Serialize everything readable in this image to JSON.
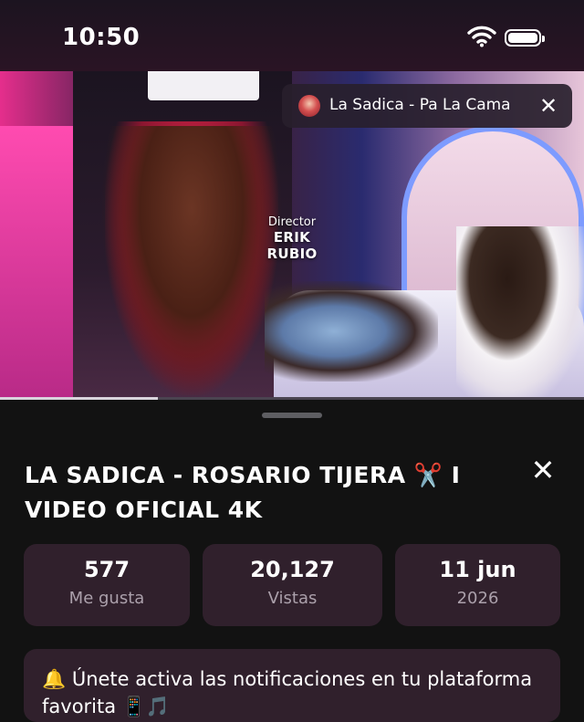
{
  "status_bar": {
    "time": "10:50"
  },
  "video": {
    "credit_role": "Director",
    "credit_name": "ERIK RUBIO",
    "progress": 0.27
  },
  "mini_player": {
    "title": "La Sadica - Pa La Cama"
  },
  "details": {
    "title": "LA SADICA - ROSARIO TIJERA ✂️ I VIDEO OFICIAL 4K",
    "stats": [
      {
        "value": "577",
        "label": "Me gusta"
      },
      {
        "value": "20,127",
        "label": "Vistas"
      },
      {
        "value": "11 jun",
        "label": "2026"
      }
    ],
    "notice": "🔔 Únete activa las notificaciones en tu plataforma favorita 📱🎵"
  },
  "icons": {
    "close": "close-icon",
    "wifi": "wifi-icon",
    "battery": "battery-icon"
  }
}
